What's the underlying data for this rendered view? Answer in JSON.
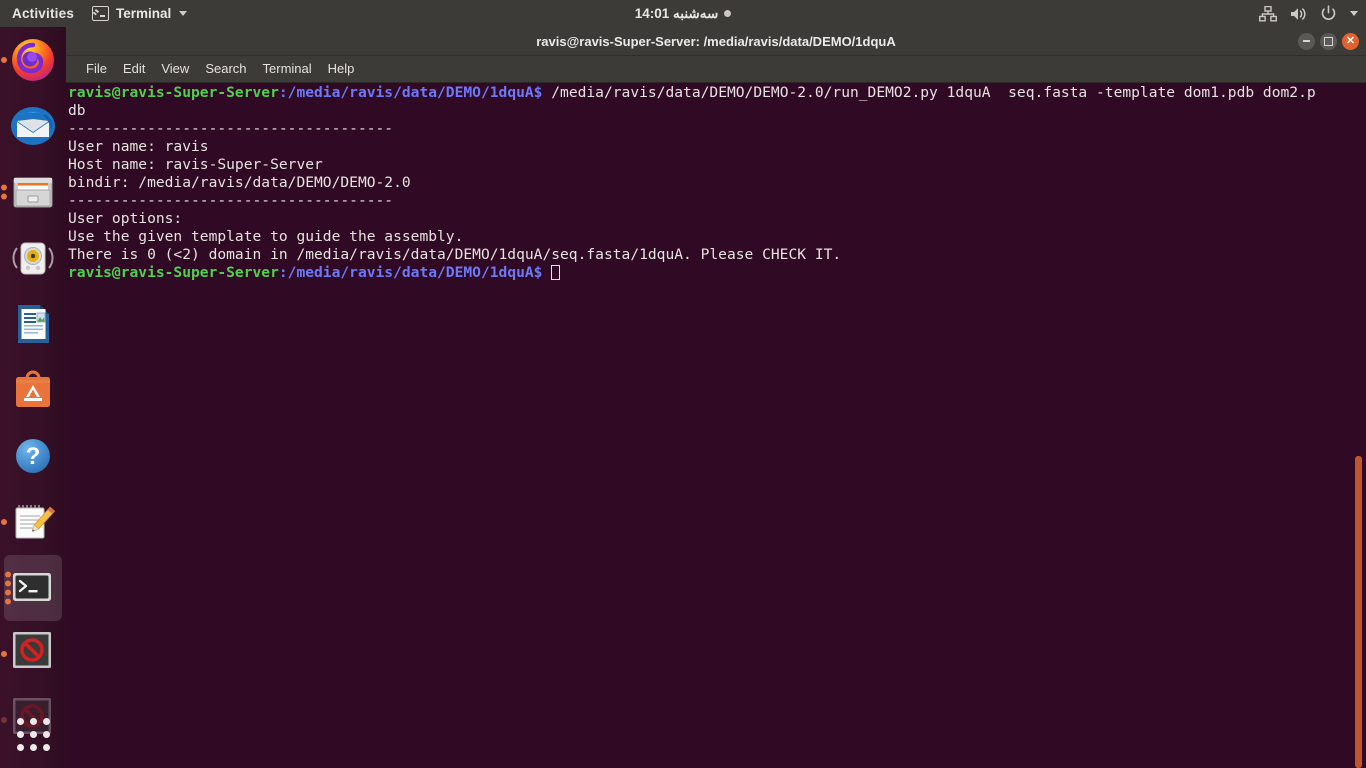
{
  "topbar": {
    "activities_label": "Activities",
    "app_name": "Terminal",
    "app_icon": "terminal-icon",
    "clock": "سه‌شنبه 14:01",
    "indicators": [
      "network-icon",
      "volume-icon",
      "power-icon",
      "chevron-down-icon"
    ]
  },
  "dock": {
    "items": [
      {
        "name": "firefox",
        "label": "Firefox Web Browser",
        "running": true,
        "active": false
      },
      {
        "name": "thunderbird",
        "label": "Thunderbird Mail",
        "running": false,
        "active": false
      },
      {
        "name": "files",
        "label": "Files",
        "running": true,
        "active": false
      },
      {
        "name": "rhythmbox",
        "label": "Rhythmbox",
        "running": false,
        "active": false
      },
      {
        "name": "libreoffice-writer",
        "label": "LibreOffice Writer",
        "running": false,
        "active": false
      },
      {
        "name": "ubuntu-software",
        "label": "Ubuntu Software",
        "running": false,
        "active": false
      },
      {
        "name": "help",
        "label": "Help",
        "running": false,
        "active": false
      },
      {
        "name": "text-editor",
        "label": "Text Editor",
        "running": true,
        "active": false
      },
      {
        "name": "terminal",
        "label": "Terminal",
        "running": true,
        "active": true
      },
      {
        "name": "blocked-app",
        "label": "Blocked Application",
        "running": true,
        "active": false
      }
    ],
    "show_applications_label": "Show Applications"
  },
  "window": {
    "title": "ravis@ravis-Super-Server: /media/ravis/data/DEMO/1dquA",
    "buttons": {
      "minimize": "–",
      "maximize": "□",
      "close": "×"
    },
    "menu": [
      "File",
      "Edit",
      "View",
      "Search",
      "Terminal",
      "Help"
    ]
  },
  "terminal": {
    "colors": {
      "background": "#300a24",
      "foreground": "#e6e2e0",
      "prompt_user": "#4fd14f",
      "prompt_path": "#6d79f7",
      "scrollbar": "#c0562c"
    },
    "prompt_user_host": "ravis@ravis-Super-Server",
    "prompt_path": ":/media/ravis/data/DEMO/1dquA$",
    "command": " /media/ravis/data/DEMO/DEMO-2.0/run_DEMO2.py 1dquA  seq.fasta -template dom1.pdb dom2.p",
    "command_wrap": "db",
    "output_lines": [
      "-------------------------------------",
      "User name: ravis",
      "Host name: ravis-Super-Server",
      "bindir: /media/ravis/data/DEMO/DEMO-2.0",
      "-------------------------------------",
      "User options:",
      "Use the given template to guide the assembly.",
      "There is 0 (<2) domain in /media/ravis/data/DEMO/1dquA/seq.fasta/1dquA. Please CHECK IT."
    ],
    "cursor": "block-outline"
  }
}
